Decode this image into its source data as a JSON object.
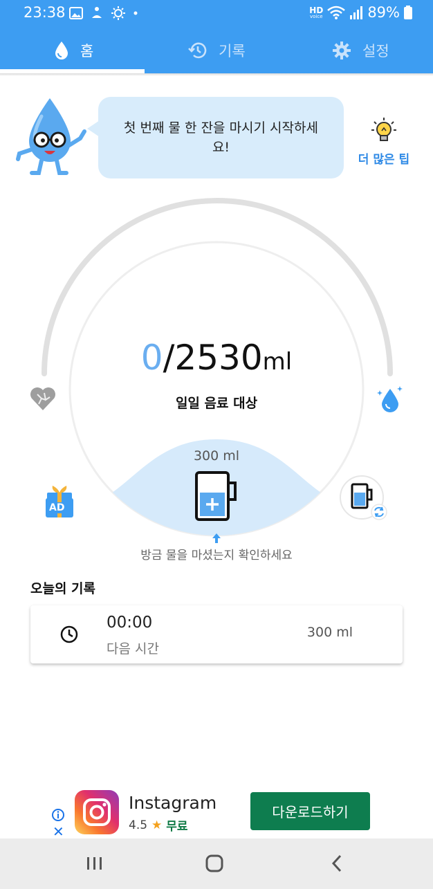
{
  "status_bar": {
    "time": "23:38",
    "battery": "89%",
    "network_badge_top": "HD",
    "network_badge_bottom": "voice"
  },
  "tabs": [
    {
      "label": "홈",
      "icon": "water-drop-icon",
      "active": true
    },
    {
      "label": "기록",
      "icon": "history-icon",
      "active": false
    },
    {
      "label": "설정",
      "icon": "gear-icon",
      "active": false
    }
  ],
  "tip": {
    "bubble_text": "첫 번째 물 한 잔을 마시기 시작하세요!",
    "more_tips_label": "더 많은 팁"
  },
  "gauge": {
    "current": "0",
    "separator": "/",
    "target": "2530",
    "unit": "ml",
    "label": "일일 음료 대상",
    "progress": 0
  },
  "cup": {
    "size_label": "300 ml",
    "confirm_text": "방금 물을 마셨는지 확인하세요"
  },
  "side_buttons": {
    "ad_badge": "AD"
  },
  "today": {
    "title": "오늘의 기록",
    "records": [
      {
        "time": "00:00",
        "note": "다음 시간",
        "amount": "300 ml"
      }
    ]
  },
  "ad": {
    "app_name": "Instagram",
    "rating": "4.5",
    "price": "무료",
    "button_label": "다운로드하기"
  },
  "colors": {
    "primary": "#3d9df2",
    "bubble": "#d8ecfb",
    "accent_text": "#2f8ae6",
    "ad_button": "#0e7d4f"
  }
}
